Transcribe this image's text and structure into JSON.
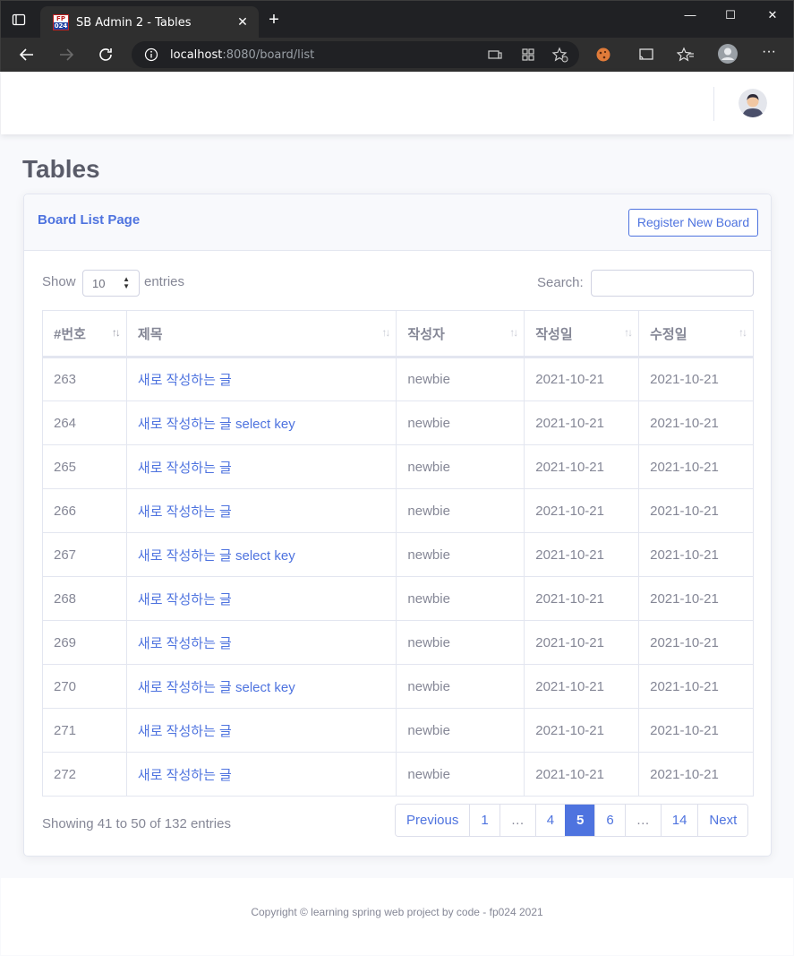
{
  "browser": {
    "tab_title": "SB Admin 2 - Tables",
    "favicon_top": "FP",
    "favicon_bottom": "024",
    "url_host": "localhost",
    "url_rest": ":8080/board/list"
  },
  "page": {
    "title": "Tables",
    "card_title": "Board List Page",
    "register_button": "Register New Board"
  },
  "datatable": {
    "show_label": "Show",
    "page_length": "10",
    "entries_label": "entries",
    "search_label": "Search:",
    "search_value": "",
    "columns": [
      "#번호",
      "제목",
      "작성자",
      "작성일",
      "수정일"
    ],
    "rows": [
      {
        "bno": "263",
        "title": "새로 작성하는 글",
        "writer": "newbie",
        "regdate": "2021-10-21",
        "updatedate": "2021-10-21"
      },
      {
        "bno": "264",
        "title": "새로 작성하는 글 select key",
        "writer": "newbie",
        "regdate": "2021-10-21",
        "updatedate": "2021-10-21"
      },
      {
        "bno": "265",
        "title": "새로 작성하는 글",
        "writer": "newbie",
        "regdate": "2021-10-21",
        "updatedate": "2021-10-21"
      },
      {
        "bno": "266",
        "title": "새로 작성하는 글",
        "writer": "newbie",
        "regdate": "2021-10-21",
        "updatedate": "2021-10-21"
      },
      {
        "bno": "267",
        "title": "새로 작성하는 글 select key",
        "writer": "newbie",
        "regdate": "2021-10-21",
        "updatedate": "2021-10-21"
      },
      {
        "bno": "268",
        "title": "새로 작성하는 글",
        "writer": "newbie",
        "regdate": "2021-10-21",
        "updatedate": "2021-10-21"
      },
      {
        "bno": "269",
        "title": "새로 작성하는 글",
        "writer": "newbie",
        "regdate": "2021-10-21",
        "updatedate": "2021-10-21"
      },
      {
        "bno": "270",
        "title": "새로 작성하는 글 select key",
        "writer": "newbie",
        "regdate": "2021-10-21",
        "updatedate": "2021-10-21"
      },
      {
        "bno": "271",
        "title": "새로 작성하는 글",
        "writer": "newbie",
        "regdate": "2021-10-21",
        "updatedate": "2021-10-21"
      },
      {
        "bno": "272",
        "title": "새로 작성하는 글",
        "writer": "newbie",
        "regdate": "2021-10-21",
        "updatedate": "2021-10-21"
      }
    ],
    "info": "Showing 41 to 50 of 132 entries",
    "pagination": [
      {
        "label": "Previous",
        "type": "nav"
      },
      {
        "label": "1",
        "type": "page"
      },
      {
        "label": "…",
        "type": "ellipsis"
      },
      {
        "label": "4",
        "type": "page"
      },
      {
        "label": "5",
        "type": "active"
      },
      {
        "label": "6",
        "type": "page"
      },
      {
        "label": "…",
        "type": "ellipsis"
      },
      {
        "label": "14",
        "type": "page"
      },
      {
        "label": "Next",
        "type": "nav"
      }
    ]
  },
  "footer": {
    "copyright": "Copyright © learning spring web project by code - fp024 2021"
  },
  "colors": {
    "primary": "#4e73df",
    "text": "#858796",
    "heading": "#5a5c69",
    "background": "#f8f9fc"
  }
}
